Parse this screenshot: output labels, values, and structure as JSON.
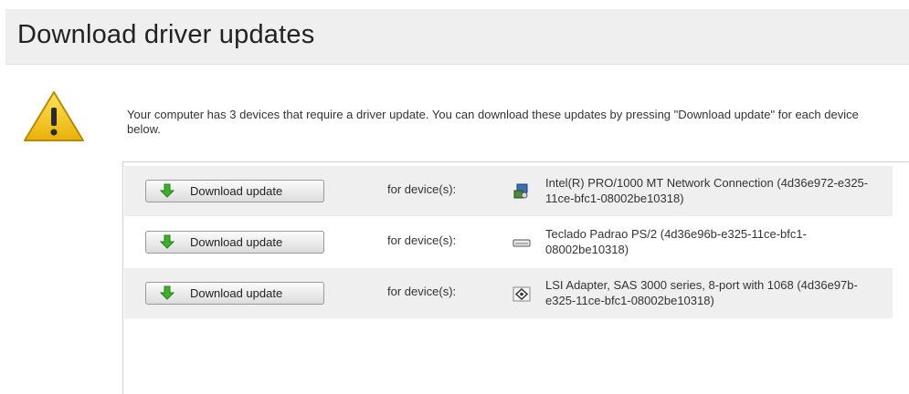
{
  "header": {
    "title": "Download driver updates"
  },
  "warning": {
    "icon": "warning-icon",
    "message": "Your computer has 3 devices that require a driver update. You can download these updates by pressing \"Download update\" for each device below."
  },
  "devices": [
    {
      "button_label": "Download update",
      "for_label": "for device(s):",
      "icon": "network-adapter-icon",
      "name": "Intel(R) PRO/1000 MT Network Connection (4d36e972-e325-11ce-bfc1-08002be10318)"
    },
    {
      "button_label": "Download update",
      "for_label": "for device(s):",
      "icon": "keyboard-icon",
      "name": "Teclado Padrao PS/2 (4d36e96b-e325-11ce-bfc1-08002be10318)"
    },
    {
      "button_label": "Download update",
      "for_label": "for device(s):",
      "icon": "storage-controller-icon",
      "name": "LSI Adapter, SAS 3000 series, 8-port with 1068 (4d36e97b-e325-11ce-bfc1-08002be10318)"
    }
  ],
  "colors": {
    "header_bg": "#efefef",
    "row_shade": "#efefef",
    "arrow_green": "#3fae2a",
    "warning_yellow": "#f5c518"
  }
}
